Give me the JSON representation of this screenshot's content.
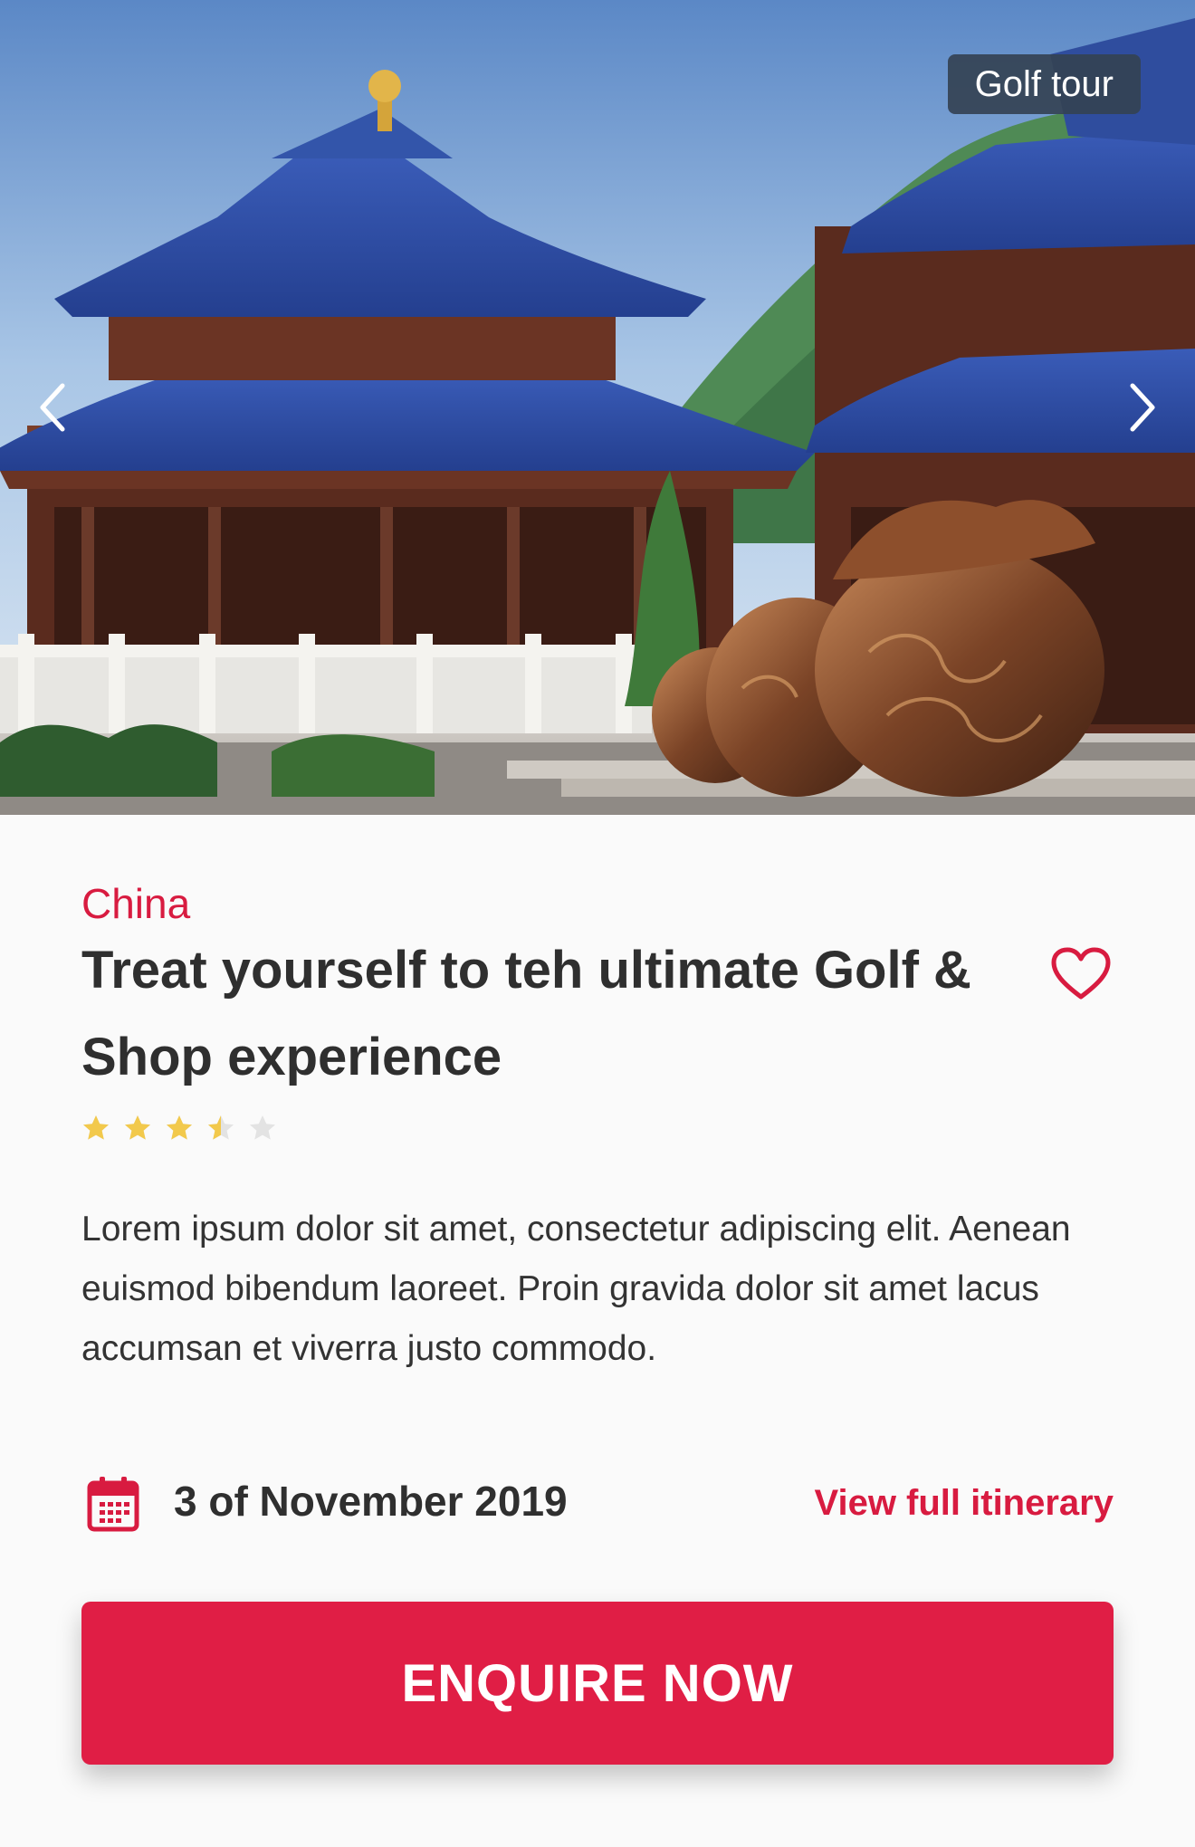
{
  "hero": {
    "tag": "Golf tour",
    "icons": {
      "prev": "chevron-left-icon",
      "next": "chevron-right-icon"
    }
  },
  "tour": {
    "country": "China",
    "title": "Treat yourself to teh ultimate Golf & Shop experience",
    "rating": 3.5,
    "rating_max": 5,
    "description": "Lorem ipsum dolor sit amet, consectetur adipiscing elit. Aenean euismod bibendum laoreet. Proin gravida dolor sit amet lacus accumsan et viverra justo commodo.",
    "date": "3 of November 2019",
    "itinerary_link": "View full itinerary",
    "cta": "ENQUIRE NOW"
  },
  "colors": {
    "accent": "#e01e45",
    "star_filled": "#f2c94c",
    "star_empty": "#e3e3e3"
  },
  "icons": {
    "favorite": "heart-icon",
    "date": "calendar-icon",
    "rating": "star-icon"
  }
}
